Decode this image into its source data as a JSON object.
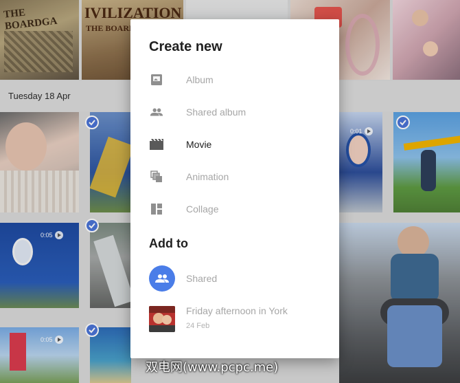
{
  "background": {
    "date_label": "Tuesday 18 Apr",
    "video_durations": [
      "0:01",
      "0:05",
      "0:05"
    ],
    "top_tile_texts": [
      "THE BOARDGA",
      "IVILIZATION",
      "THE BOARDGAME"
    ]
  },
  "dialog": {
    "title": "Create new",
    "create_items": [
      {
        "label": "Album",
        "icon": "album-icon",
        "enabled": false
      },
      {
        "label": "Shared album",
        "icon": "people-icon",
        "enabled": false
      },
      {
        "label": "Movie",
        "icon": "movie-icon",
        "enabled": true
      },
      {
        "label": "Animation",
        "icon": "animation-icon",
        "enabled": false
      },
      {
        "label": "Collage",
        "icon": "collage-icon",
        "enabled": false
      }
    ],
    "add_to_title": "Add to",
    "add_to_items": [
      {
        "label": "Shared",
        "icon": "people-icon"
      },
      {
        "label": "Friday afternoon in York",
        "date": "24 Feb"
      }
    ]
  },
  "watermark": "双电网(www.pcpc.me)",
  "colors": {
    "accent": "#4a7de8",
    "check": "#4a74d6",
    "disabled_text": "#a6a6a6",
    "title_text": "#212121"
  }
}
